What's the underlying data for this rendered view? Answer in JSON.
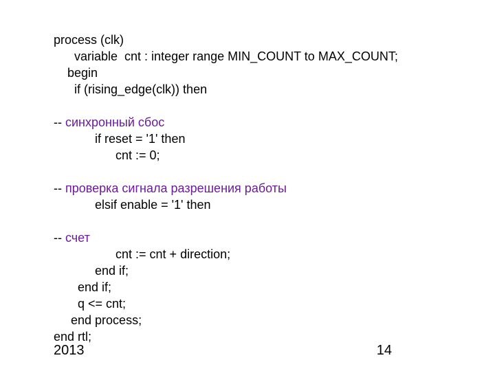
{
  "code": {
    "l1": "process (clk)",
    "l2": "      variable  cnt : integer range MIN_COUNT to MAX_COUNT;",
    "l3": "    begin",
    "l4": "      if (rising_edge(clk)) then",
    "c1_dash": "-- ",
    "c1_text": "синхронный сбос",
    "l5": "            if reset = '1' then",
    "l6": "                  cnt := 0;",
    "c2_dash": "-- ",
    "c2_text": "проверка сигнала разрешения работы",
    "l7": "            elsif enable = '1' then",
    "c3_dash": "-- ",
    "c3_text": "счет",
    "l8": "                  cnt := cnt + direction;",
    "l9": "            end if;",
    "l10": "       end if;",
    "l11": "       q <= cnt;",
    "l12": "     end process;",
    "l13": "end rtl;"
  },
  "footer": {
    "year": "2013",
    "page": "14"
  }
}
